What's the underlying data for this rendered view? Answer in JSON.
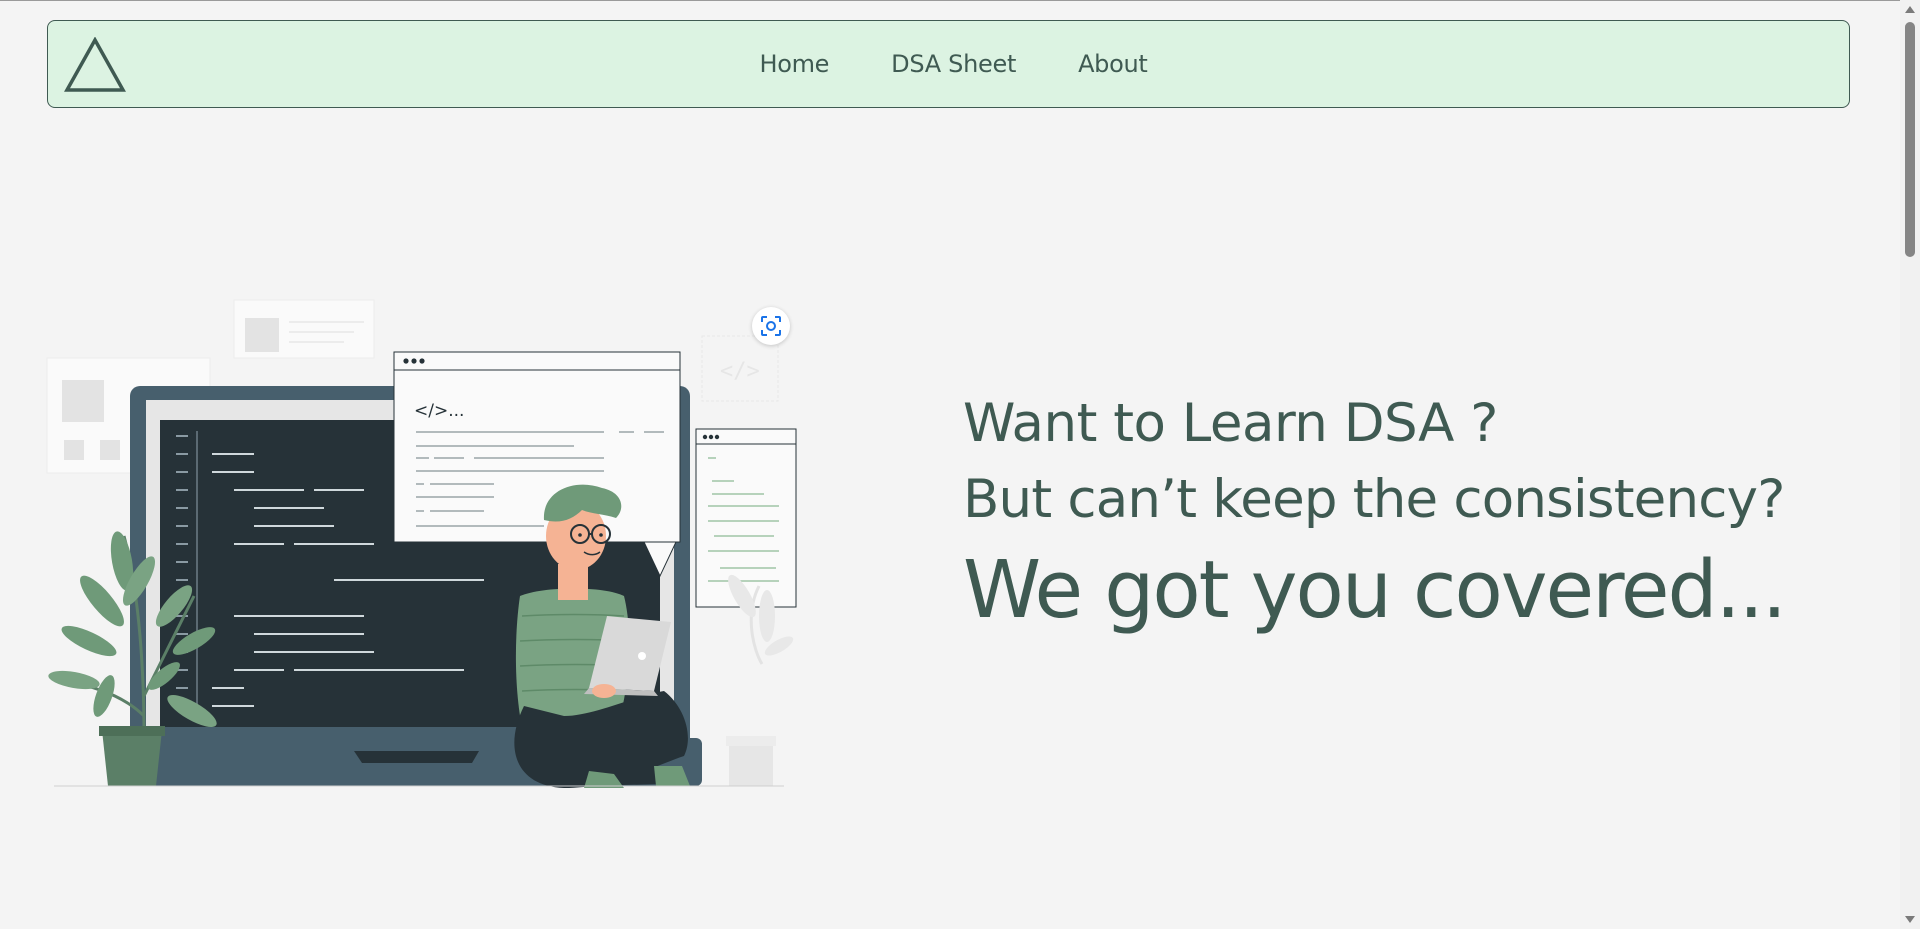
{
  "nav": {
    "logo_icon": "triangle-logo-icon",
    "links": [
      "Home",
      "DSA Sheet",
      "About"
    ]
  },
  "hero": {
    "line1": "Want to Learn DSA ?",
    "line2": "But can’t keep the consistency?",
    "line3": "We got you covered..."
  },
  "illustration": {
    "code_tag": "</>...",
    "lens_icon": "google-lens-icon"
  },
  "colors": {
    "primary": "#3f5a52",
    "nav_bg": "#dcf3e2",
    "page_bg": "#f4f4f4",
    "accent_green": "#7aa383"
  }
}
